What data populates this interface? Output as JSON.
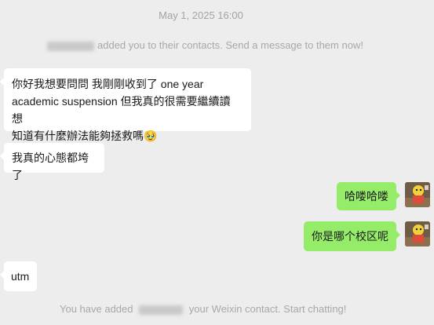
{
  "chat": {
    "timestamp": "May 1, 2025 16:00",
    "system_added_contacts": "added you to their contacts. Send a message to them now!",
    "messages": {
      "msg1_line1": "你好我想要問問 我剛剛收到了 one year",
      "msg1_line2": "academic suspension 但我真的很需要繼續讀 想",
      "msg1_line3": "知道有什麼辦法能夠拯救嗎",
      "msg1_emoji": "🥹",
      "msg2": "我真的心態都垮了",
      "msg3": "哈喽哈喽",
      "msg4": "你是哪个校区呢",
      "msg5": "utm"
    },
    "system_added_start": "You have added",
    "system_added_end": "your Weixin contact. Start chatting!"
  },
  "colors": {
    "background": "#ededed",
    "incoming_bubble": "#ffffff",
    "outgoing_bubble": "#95ec69",
    "system_text": "#a8a8a8"
  }
}
